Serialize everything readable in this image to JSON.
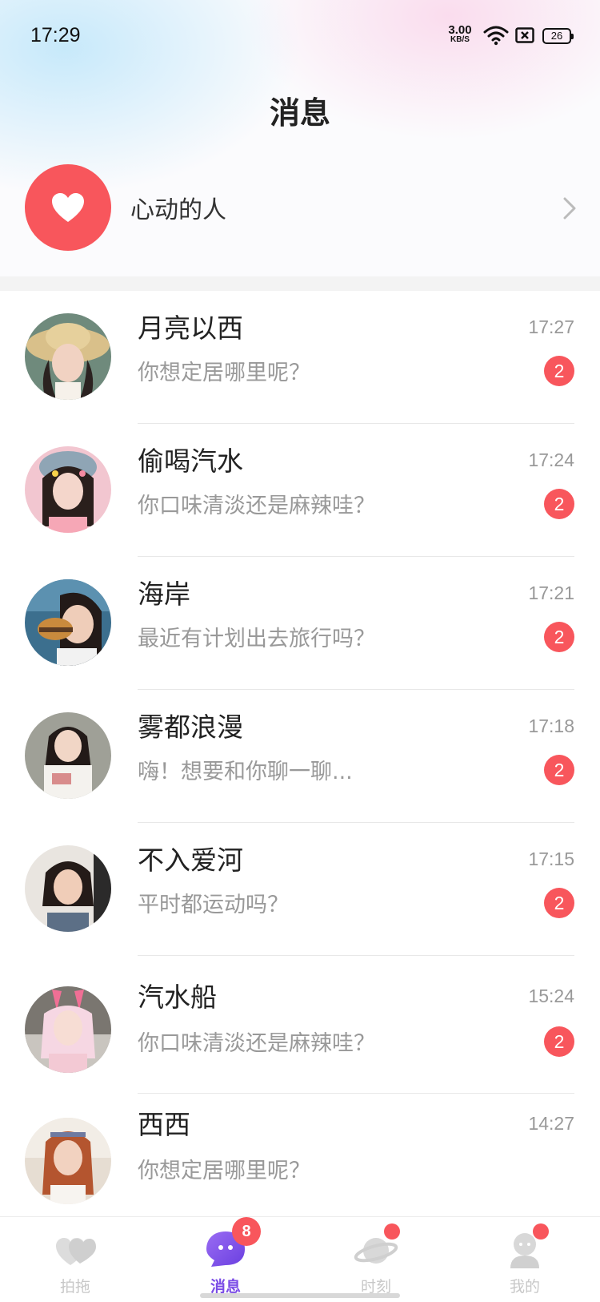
{
  "status_bar": {
    "time": "17:29",
    "speed_value": "3.00",
    "speed_unit": "KB/S",
    "battery": "26"
  },
  "page_title": "消息",
  "favorites": {
    "label": "心动的人",
    "icon": "heart-icon",
    "accent": "#f8565c"
  },
  "chats": [
    {
      "name": "月亮以西",
      "message": "你想定居哪里呢？",
      "time": "17:27",
      "unread": "2"
    },
    {
      "name": "偷喝汽水",
      "message": "你口味清淡还是麻辣哇？",
      "time": "17:24",
      "unread": "2"
    },
    {
      "name": "海岸",
      "message": "最近有计划出去旅行吗？",
      "time": "17:21",
      "unread": "2"
    },
    {
      "name": "雾都浪漫",
      "message": "嗨！想要和你聊一聊...",
      "time": "17:18",
      "unread": "2"
    },
    {
      "name": "不入爱河",
      "message": "平时都运动吗？",
      "time": "17:15",
      "unread": "2"
    },
    {
      "name": "汽水船",
      "message": "你口味清淡还是麻辣哇？",
      "time": "15:24",
      "unread": "2"
    },
    {
      "name": "西西",
      "message": "你想定居哪里呢？",
      "time": "14:27",
      "unread": ""
    }
  ],
  "bottom_nav": [
    {
      "label": "拍拖",
      "icon": "heart-tab-icon",
      "active": false
    },
    {
      "label": "消息",
      "icon": "chat-bubble-icon",
      "active": true,
      "count": "8"
    },
    {
      "label": "时刻",
      "icon": "planet-icon",
      "active": false
    },
    {
      "label": "我的",
      "icon": "profile-icon",
      "active": false
    }
  ],
  "colors": {
    "accent_red": "#f8565c",
    "active_tab": "#7b4ce6"
  }
}
